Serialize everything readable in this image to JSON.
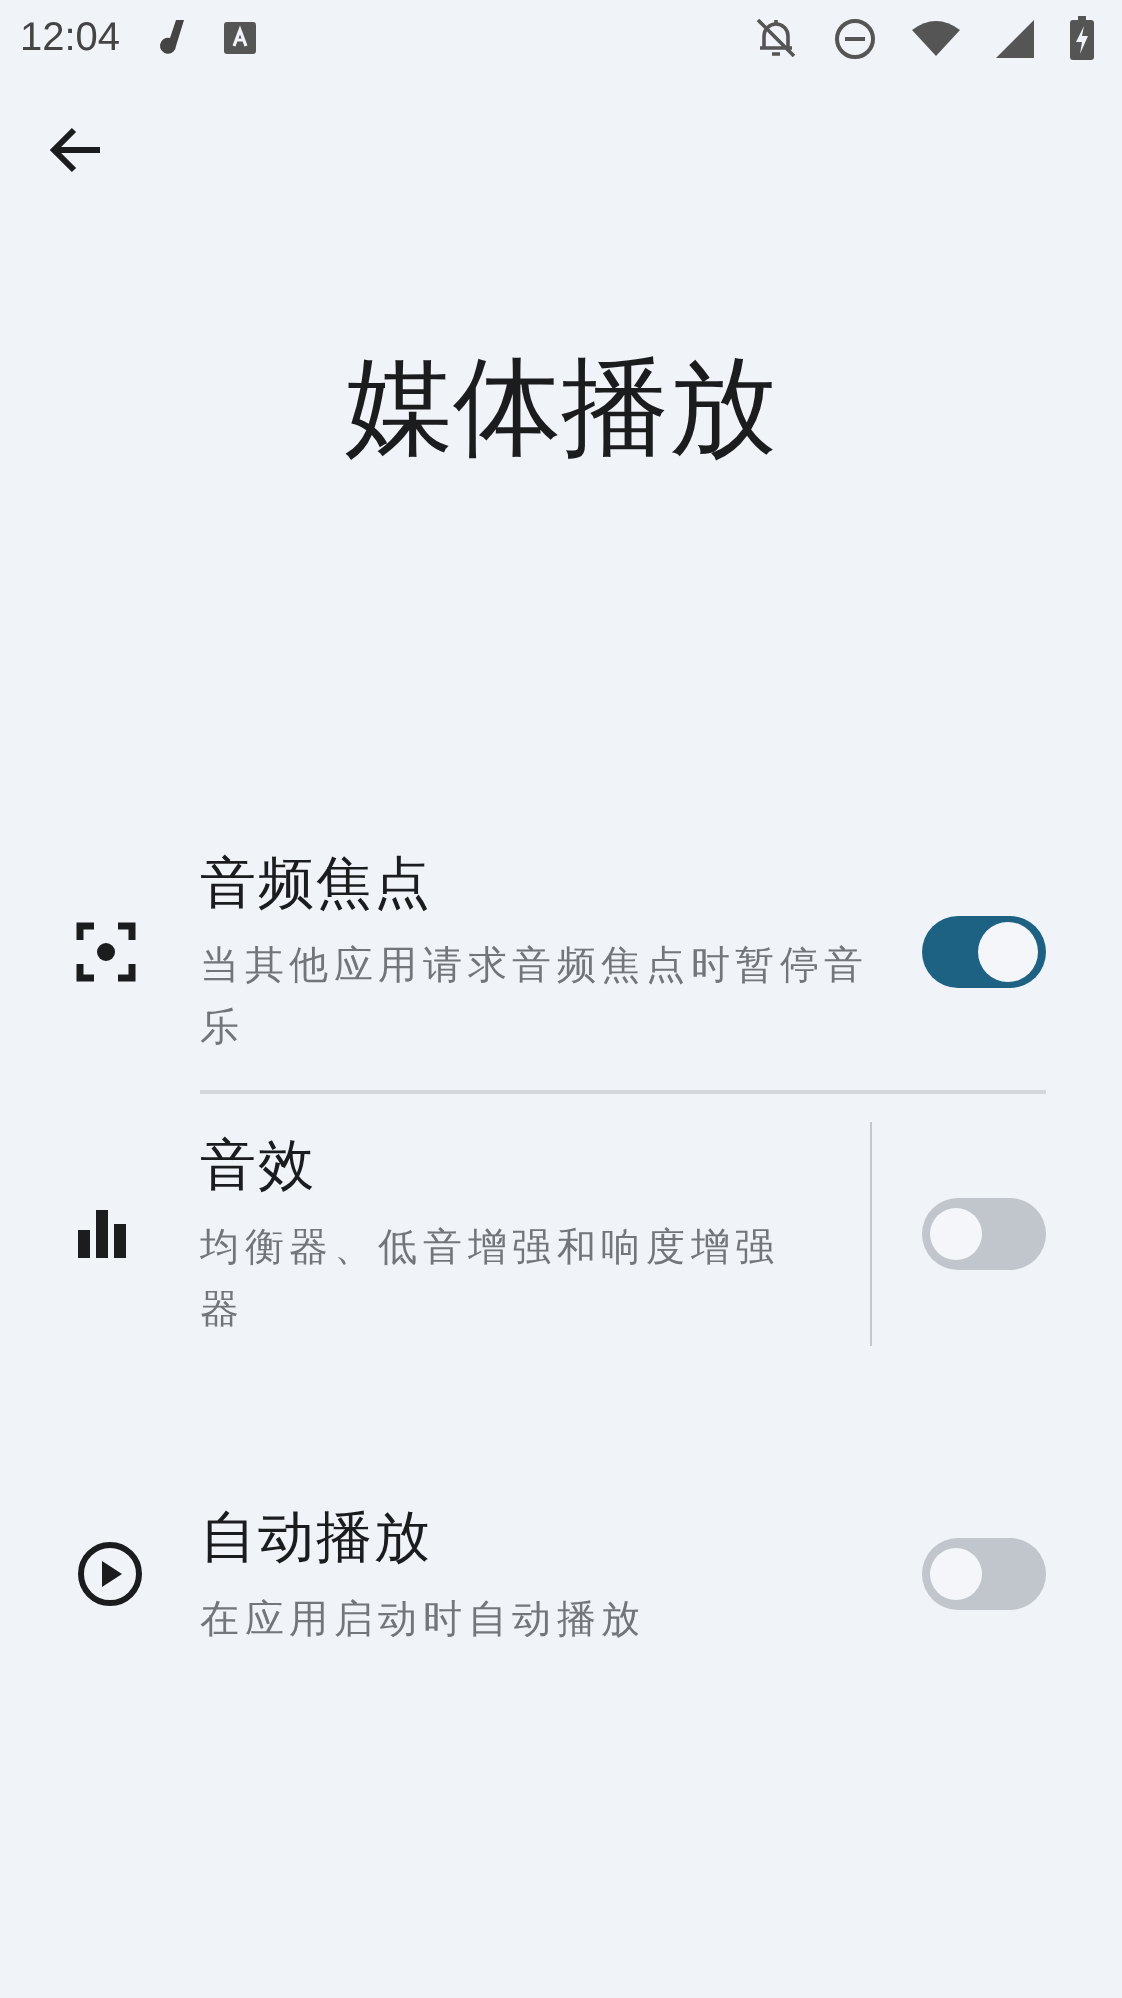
{
  "status_bar": {
    "time": "12:04"
  },
  "title": "媒体播放",
  "items": [
    {
      "kind": "focus",
      "title": "音频焦点",
      "subtitle": "当其他应用请求音频焦点时暂停音乐",
      "on": true
    },
    {
      "kind": "effects",
      "title": "音效",
      "subtitle": "均衡器、低音增强和响度增强器",
      "on": false
    },
    {
      "kind": "autoplay",
      "title": "自动播放",
      "subtitle": "在应用启动时自动播放",
      "on": false
    }
  ]
}
